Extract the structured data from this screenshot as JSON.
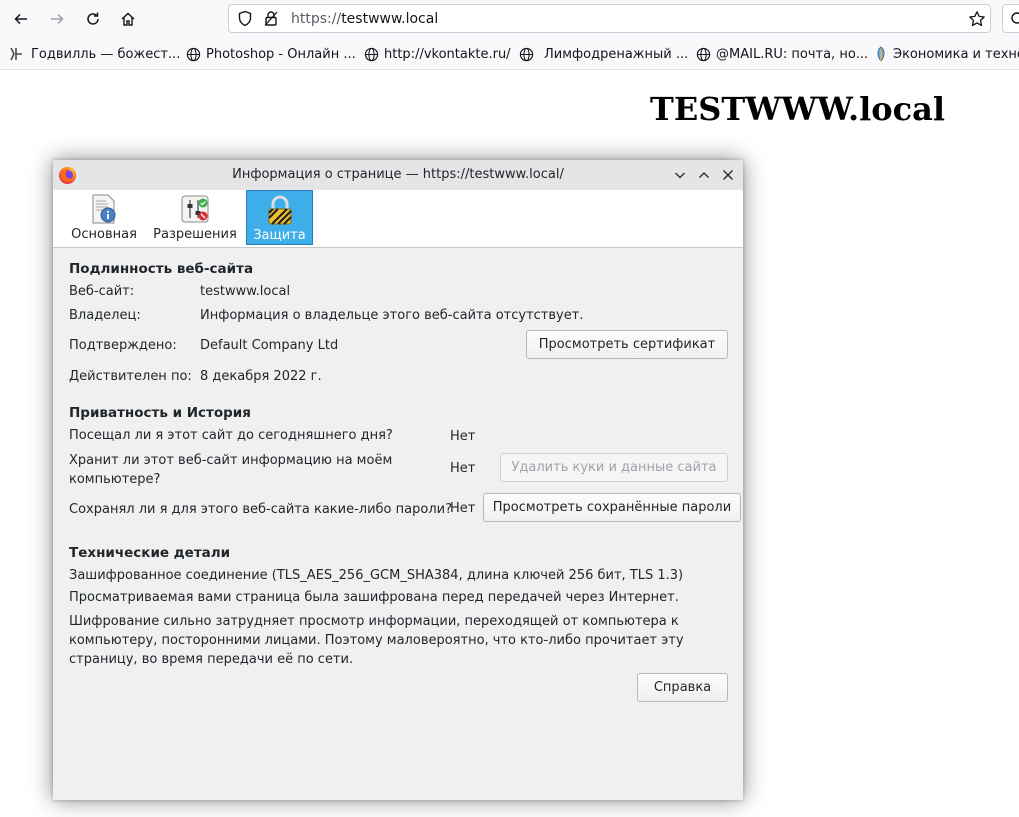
{
  "browser": {
    "url_scheme": "https://",
    "url_host": "testwww.local",
    "bookmarks": [
      {
        "label": "Годвилль — божест...",
        "icon": "godville-icon"
      },
      {
        "label": "Photoshop - Онлайн ...",
        "icon": "globe-icon"
      },
      {
        "label": "http://vkontakte.ru/",
        "icon": "globe-icon"
      },
      {
        "label": "Лимфодренажный ...",
        "icon": "globe-icon"
      },
      {
        "label": "@MAIL.RU: почта, но...",
        "icon": "globe-icon"
      },
      {
        "label": "Экономика и техно",
        "icon": "leaf-icon"
      }
    ]
  },
  "page": {
    "heading": "TESTWWW.local"
  },
  "dialog": {
    "title": "Информация о странице — https://testwww.local/",
    "tabs": [
      {
        "label": "Основная",
        "icon": "info-page-icon",
        "active": false
      },
      {
        "label": "Разрешения",
        "icon": "permissions-icon",
        "active": false
      },
      {
        "label": "Защита",
        "icon": "lock-icon",
        "active": true
      }
    ],
    "identity": {
      "heading": "Подлинность веб-сайта",
      "website_label": "Веб-сайт:",
      "website_value": "testwww.local",
      "owner_label": "Владелец:",
      "owner_value": "Информация о владельце этого веб-сайта отсутствует.",
      "verified_label": "Подтверждено:",
      "verified_value": "Default Company Ltd",
      "view_cert_button": "Просмотреть сертификат",
      "expires_label": "Действителен по:",
      "expires_value": "8 декабря 2022 г."
    },
    "privacy": {
      "heading": "Приватность и История",
      "visited_q": "Посещал ли я этот сайт до сегодняшнего дня?",
      "visited_a": "Нет",
      "storing_q": "Хранит ли этот веб-сайт информацию на моём компьютере?",
      "storing_a": "Нет",
      "clear_cookies_button": "Удалить куки и данные сайта",
      "passwords_q": "Сохранял ли я для этого веб-сайта какие-либо пароли?",
      "passwords_a": "Нет",
      "view_passwords_button": "Просмотреть сохранённые пароли"
    },
    "technical": {
      "heading": "Технические детали",
      "line1": "Зашифрованное соединение (TLS_AES_256_GCM_SHA384, длина ключей 256 бит, TLS 1.3)",
      "line2": "Просматриваемая вами страница была зашифрована перед передачей через Интернет.",
      "line3": "Шифрование сильно затрудняет просмотр информации, переходящей от компьютера к компьютеру, посторонними лицами. Поэтому маловероятно, что кто-либо прочитает эту страницу, во время передачи её по сети."
    },
    "help_button": "Справка"
  }
}
